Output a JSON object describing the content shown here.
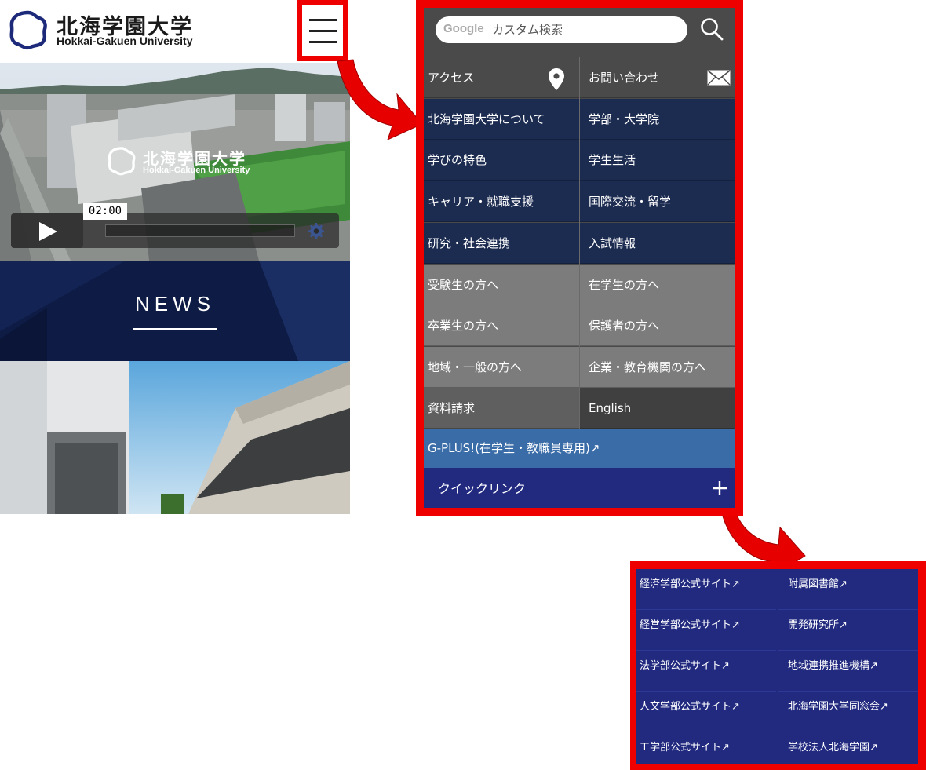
{
  "header": {
    "logo_jp": "北海学園大学",
    "logo_en": "Hokkai-Gakuen University",
    "menu_icon": "hamburger-icon"
  },
  "hero": {
    "logo_jp": "北海学園大学",
    "logo_en": "Hokkai-Gakuen University",
    "video_time": "02:00"
  },
  "news": {
    "title": "NEWS"
  },
  "menu": {
    "search_brand": "Google",
    "search_placeholder": "カスタム検索",
    "rows": [
      {
        "left": "アクセス",
        "right": "お問い合わせ",
        "style": "dark"
      },
      {
        "left": "北海学園大学について",
        "right": "学部・大学院",
        "style": "navy"
      },
      {
        "left": "学びの特色",
        "right": "学生生活",
        "style": "navy"
      },
      {
        "left": "キャリア・就職支援",
        "right": "国際交流・留学",
        "style": "navy"
      },
      {
        "left": "研究・社会連携",
        "right": "入試情報",
        "style": "navy"
      },
      {
        "left": "受験生の方へ",
        "right": "在学生の方へ",
        "style": "gray"
      },
      {
        "left": "卒業生の方へ",
        "right": "保護者の方へ",
        "style": "gray"
      },
      {
        "left": "地域・一般の方へ",
        "right": "企業・教育機関の方へ",
        "style": "gray"
      },
      {
        "left": "資料請求",
        "right": "English",
        "style": "mixed"
      }
    ],
    "gplus": "G-PLUS!(在学生・教職員専用)↗",
    "quick": "クイックリンク"
  },
  "quick_links": {
    "left": [
      "経済学部公式サイト↗",
      "経営学部公式サイト↗",
      "法学部公式サイト↗",
      "人文学部公式サイト↗",
      "工学部公式サイト↗"
    ],
    "right": [
      "附属図書館↗",
      "開発研究所↗",
      "地域連携推進機構↗",
      "北海学園大学同窓会↗",
      "学校法人北海学園↗"
    ]
  },
  "colors": {
    "highlight": "#ee0000",
    "navy": "#1c2b50",
    "quick": "#222a80",
    "gplus": "#3a6ca8"
  }
}
